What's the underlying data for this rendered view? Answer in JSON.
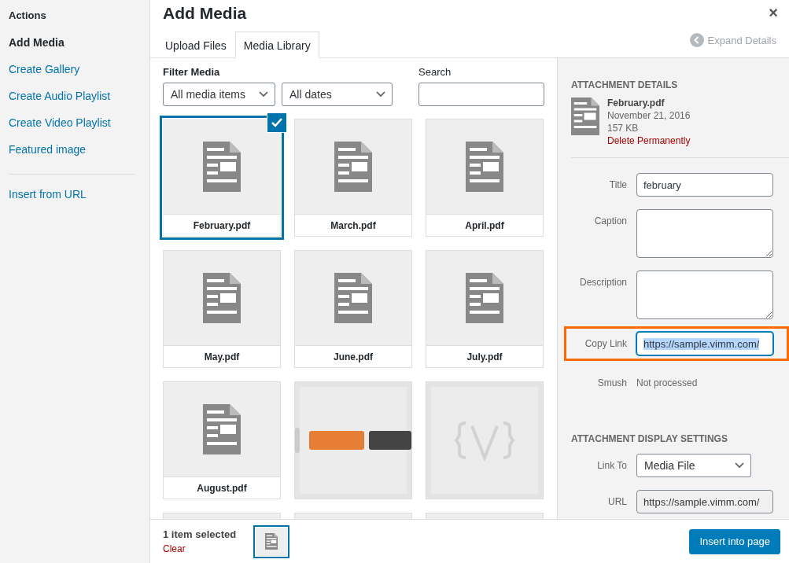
{
  "sidebar": {
    "heading": "Actions",
    "items": [
      {
        "label": "Add Media",
        "selected": true
      },
      {
        "label": "Create Gallery",
        "selected": false
      },
      {
        "label": "Create Audio Playlist",
        "selected": false
      },
      {
        "label": "Create Video Playlist",
        "selected": false
      },
      {
        "label": "Featured image",
        "selected": false
      }
    ],
    "extra_items": [
      {
        "label": "Insert from URL",
        "selected": false
      }
    ]
  },
  "window": {
    "title": "Add Media",
    "close": "×"
  },
  "tabs": [
    {
      "label": "Upload Files",
      "selected": false
    },
    {
      "label": "Media Library",
      "selected": true
    }
  ],
  "expand_details": "Expand Details",
  "filter": {
    "label": "Filter Media",
    "type_select": "All media items",
    "date_select": "All dates",
    "search_label": "Search"
  },
  "tiles": [
    {
      "kind": "document",
      "label": "February.pdf",
      "selected": true
    },
    {
      "kind": "document",
      "label": "March.pdf",
      "selected": false
    },
    {
      "kind": "document",
      "label": "April.pdf",
      "selected": false
    },
    {
      "kind": "document",
      "label": "May.pdf",
      "selected": false
    },
    {
      "kind": "document",
      "label": "June.pdf",
      "selected": false
    },
    {
      "kind": "document",
      "label": "July.pdf",
      "selected": false
    },
    {
      "kind": "document",
      "label": "August.pdf",
      "selected": false
    },
    {
      "kind": "picture",
      "selected": false
    },
    {
      "kind": "picture",
      "selected": false
    },
    {
      "kind": "hidden",
      "selected": false
    },
    {
      "kind": "hidden",
      "selected": false
    },
    {
      "kind": "hidden",
      "selected": false
    }
  ],
  "details": {
    "heading": "ATTACHMENT DETAILS",
    "file_name": "February.pdf",
    "date": "November 21, 2016",
    "size": "157 KB",
    "delete_link": "Delete Permanently"
  },
  "fields": [
    {
      "kind": "input",
      "label": "Title",
      "value": "february",
      "highlighted": false
    },
    {
      "kind": "textarea",
      "label": "Caption",
      "highlighted": false
    },
    {
      "kind": "textarea",
      "label": "Description",
      "highlighted": false
    },
    {
      "kind": "input",
      "label": "Copy Link",
      "value": "https://sample.vimm.com/",
      "highlighted": true,
      "text_selected": true
    },
    {
      "kind": "text",
      "label": "Smush",
      "value": "Not processed",
      "highlighted": false
    }
  ],
  "display_settings": {
    "heading": "ATTACHMENT DISPLAY SETTINGS",
    "link_to": {
      "label": "Link To",
      "value": "Media File"
    },
    "url": {
      "label": "URL",
      "value": "https://sample.vimm.com/"
    }
  },
  "footer": {
    "selection_count": "1 item selected",
    "clear": "Clear",
    "insert_button": "Insert into page"
  }
}
